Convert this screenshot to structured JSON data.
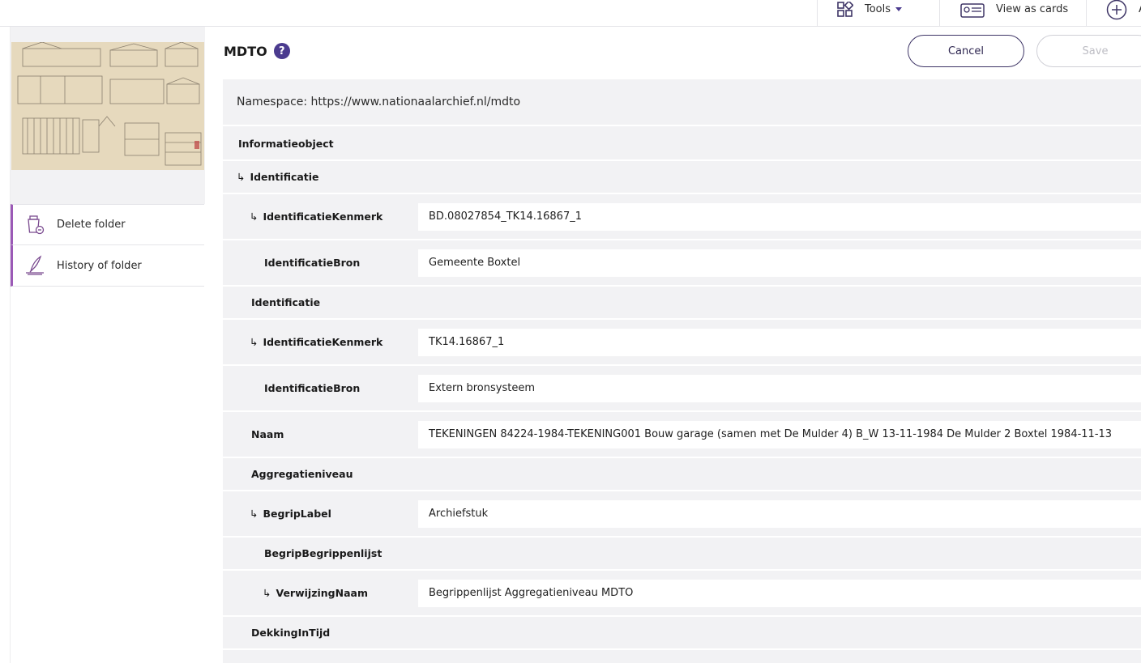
{
  "toolbar": {
    "tools_label": "Tools",
    "cards_label": "View as cards",
    "add_label": "A"
  },
  "sidebar": {
    "items": [
      {
        "label": "Delete folder",
        "icon": "delete-folder-icon"
      },
      {
        "label": "History of folder",
        "icon": "history-quill-icon"
      }
    ]
  },
  "main": {
    "title": "MDTO",
    "help": "?",
    "cancel_label": "Cancel",
    "save_label": "Save",
    "namespace": "Namespace: https://www.nationaalarchief.nl/mdto",
    "rows": [
      {
        "label": "Informatieobject",
        "arrow": "",
        "value": null
      },
      {
        "label": "Identificatie",
        "arrow": "↳ ",
        "value": null
      },
      {
        "label": "IdentificatieKenmerk",
        "arrow": "↳ ",
        "value": "BD.08027854_TK14.16867_1"
      },
      {
        "label": "IdentificatieBron",
        "arrow": "",
        "value": "Gemeente Boxtel"
      },
      {
        "label": "Identificatie",
        "arrow": "",
        "value": null
      },
      {
        "label": "IdentificatieKenmerk",
        "arrow": "↳ ",
        "value": "TK14.16867_1"
      },
      {
        "label": "IdentificatieBron",
        "arrow": "",
        "value": "Extern bronsysteem"
      },
      {
        "label": "Naam",
        "arrow": "",
        "value": "TEKENINGEN 84224-1984-TEKENING001 Bouw garage (samen met De Mulder 4) B_W 13-11-1984 De Mulder 2 Boxtel 1984-11-13"
      },
      {
        "label": "Aggregatieniveau",
        "arrow": "",
        "value": null
      },
      {
        "label": "BegripLabel",
        "arrow": "↳ ",
        "value": "Archiefstuk"
      },
      {
        "label": "BegripBegrippenlijst",
        "arrow": "",
        "value": null
      },
      {
        "label": "VerwijzingNaam",
        "arrow": "↳ ",
        "value": "Begrippenlijst Aggregatieniveau MDTO"
      },
      {
        "label": "DekkingInTijd",
        "arrow": "",
        "value": null
      }
    ]
  },
  "colors": {
    "accent": "#4b3b8f",
    "sidebar_marker": "#9b59b6",
    "panel_bg": "#f2f2f4"
  }
}
